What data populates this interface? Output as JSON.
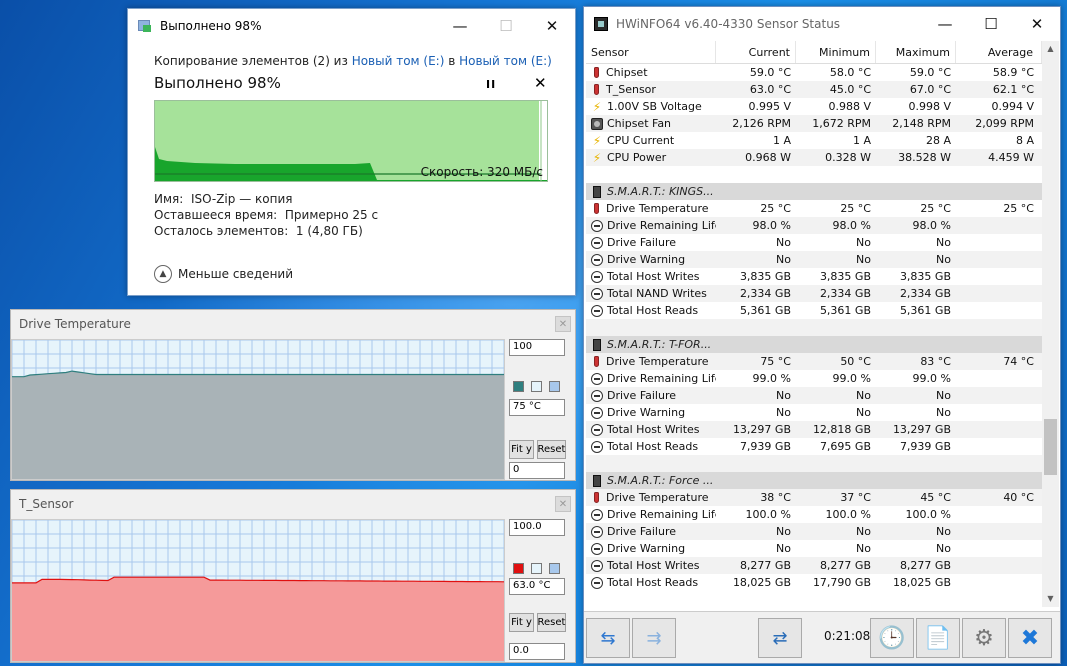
{
  "copy_dialog": {
    "title": "Выполнено 98%",
    "line_prefix": "Копирование элементов (2) из ",
    "source": "Новый том (E:)",
    "line_mid": " в ",
    "dest": "Новый том (E:)",
    "percent_text": "Выполнено 98%",
    "speed": "Скорость: 320 МБ/с",
    "name_label": "Имя:",
    "name_value": "ISO-Zip — копия",
    "time_label": "Оставшееся время:",
    "time_value": "Примерно 25 с",
    "items_label": "Осталось элементов:",
    "items_value": "1 (4,80 ГБ)",
    "less_details": "Меньше сведений",
    "progress": 0.98,
    "pause_glyph": "II",
    "close_glyph": "✕"
  },
  "graph_drive_temp": {
    "title": "Drive Temperature",
    "max": "100",
    "current": "75 °C",
    "min": "0",
    "fit_label": "Fit y",
    "reset_label": "Reset",
    "color": "#2f7f7f"
  },
  "graph_t_sensor": {
    "title": "T_Sensor",
    "max": "100.0",
    "current": "63.0 °C",
    "min": "0.0",
    "fit_label": "Fit y",
    "reset_label": "Reset",
    "color": "#e01010"
  },
  "hwinfo": {
    "title": "HWiNFO64 v6.40-4330 Sensor Status",
    "columns": [
      "Sensor",
      "Current",
      "Minimum",
      "Maximum",
      "Average"
    ],
    "timer": "0:21:08",
    "rows": [
      {
        "icon": "thermo",
        "name": "Chipset",
        "cur": "59.0 °C",
        "min": "58.0 °C",
        "max": "59.0 °C",
        "avg": "58.9 °C"
      },
      {
        "icon": "thermo",
        "name": "T_Sensor",
        "cur": "63.0 °C",
        "min": "45.0 °C",
        "max": "67.0 °C",
        "avg": "62.1 °C"
      },
      {
        "icon": "bolt",
        "name": "1.00V SB Voltage",
        "cur": "0.995 V",
        "min": "0.988 V",
        "max": "0.998 V",
        "avg": "0.994 V"
      },
      {
        "icon": "fan",
        "name": "Chipset Fan",
        "cur": "2,126 RPM",
        "min": "1,672 RPM",
        "max": "2,148 RPM",
        "avg": "2,099 RPM"
      },
      {
        "icon": "bolt",
        "name": "CPU Current",
        "cur": "1 A",
        "min": "1 A",
        "max": "28 A",
        "avg": "8 A"
      },
      {
        "icon": "bolt",
        "name": "CPU Power",
        "cur": "0.968 W",
        "min": "0.328 W",
        "max": "38.528 W",
        "avg": "4.459 W"
      },
      {
        "icon": "none",
        "name": "",
        "cur": "",
        "min": "",
        "max": "",
        "avg": ""
      },
      {
        "icon": "disk",
        "group": true,
        "name": "S.M.A.R.T.: KINGS...",
        "cur": "",
        "min": "",
        "max": "",
        "avg": ""
      },
      {
        "icon": "thermo",
        "name": "Drive Temperature",
        "cur": "25 °C",
        "min": "25 °C",
        "max": "25 °C",
        "avg": "25 °C"
      },
      {
        "icon": "circle",
        "name": "Drive Remaining Life",
        "cur": "98.0 %",
        "min": "98.0 %",
        "max": "98.0 %",
        "avg": ""
      },
      {
        "icon": "circle",
        "name": "Drive Failure",
        "cur": "No",
        "min": "No",
        "max": "No",
        "avg": ""
      },
      {
        "icon": "circle",
        "name": "Drive Warning",
        "cur": "No",
        "min": "No",
        "max": "No",
        "avg": ""
      },
      {
        "icon": "circle",
        "name": "Total Host Writes",
        "cur": "3,835 GB",
        "min": "3,835 GB",
        "max": "3,835 GB",
        "avg": ""
      },
      {
        "icon": "circle",
        "name": "Total NAND Writes",
        "cur": "2,334 GB",
        "min": "2,334 GB",
        "max": "2,334 GB",
        "avg": ""
      },
      {
        "icon": "circle",
        "name": "Total Host Reads",
        "cur": "5,361 GB",
        "min": "5,361 GB",
        "max": "5,361 GB",
        "avg": ""
      },
      {
        "icon": "none",
        "name": "",
        "cur": "",
        "min": "",
        "max": "",
        "avg": ""
      },
      {
        "icon": "disk",
        "group": true,
        "name": "S.M.A.R.T.: T-FOR...",
        "cur": "",
        "min": "",
        "max": "",
        "avg": ""
      },
      {
        "icon": "thermo",
        "name": "Drive Temperature",
        "cur": "75 °C",
        "min": "50 °C",
        "max": "83 °C",
        "avg": "74 °C"
      },
      {
        "icon": "circle",
        "name": "Drive Remaining Life",
        "cur": "99.0 %",
        "min": "99.0 %",
        "max": "99.0 %",
        "avg": ""
      },
      {
        "icon": "circle",
        "name": "Drive Failure",
        "cur": "No",
        "min": "No",
        "max": "No",
        "avg": ""
      },
      {
        "icon": "circle",
        "name": "Drive Warning",
        "cur": "No",
        "min": "No",
        "max": "No",
        "avg": ""
      },
      {
        "icon": "circle",
        "name": "Total Host Writes",
        "cur": "13,297 GB",
        "min": "12,818 GB",
        "max": "13,297 GB",
        "avg": ""
      },
      {
        "icon": "circle",
        "name": "Total Host Reads",
        "cur": "7,939 GB",
        "min": "7,695 GB",
        "max": "7,939 GB",
        "avg": ""
      },
      {
        "icon": "none",
        "name": "",
        "cur": "",
        "min": "",
        "max": "",
        "avg": ""
      },
      {
        "icon": "disk",
        "group": true,
        "name": "S.M.A.R.T.: Force ...",
        "cur": "",
        "min": "",
        "max": "",
        "avg": ""
      },
      {
        "icon": "thermo",
        "name": "Drive Temperature",
        "cur": "38 °C",
        "min": "37 °C",
        "max": "45 °C",
        "avg": "40 °C"
      },
      {
        "icon": "circle",
        "name": "Drive Remaining Life",
        "cur": "100.0 %",
        "min": "100.0 %",
        "max": "100.0 %",
        "avg": ""
      },
      {
        "icon": "circle",
        "name": "Drive Failure",
        "cur": "No",
        "min": "No",
        "max": "No",
        "avg": ""
      },
      {
        "icon": "circle",
        "name": "Drive Warning",
        "cur": "No",
        "min": "No",
        "max": "No",
        "avg": ""
      },
      {
        "icon": "circle",
        "name": "Total Host Writes",
        "cur": "8,277 GB",
        "min": "8,277 GB",
        "max": "8,277 GB",
        "avg": ""
      },
      {
        "icon": "circle",
        "name": "Total Host Reads",
        "cur": "18,025 GB",
        "min": "17,790 GB",
        "max": "18,025 GB",
        "avg": ""
      }
    ]
  },
  "window_controls": {
    "minimize": "—",
    "maximize": "☐",
    "close": "✕"
  }
}
